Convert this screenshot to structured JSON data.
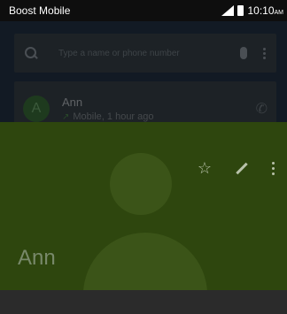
{
  "status_bar": {
    "carrier": "Boost Mobile",
    "time": "10:10",
    "time_suffix": "AM"
  },
  "search": {
    "placeholder": "Type a name or phone number"
  },
  "recent_call": {
    "avatar_letter": "A",
    "name": "Ann",
    "detail": "Mobile, 1 hour ago"
  },
  "contact": {
    "name": "Ann"
  },
  "colors": {
    "header": "#2e460e",
    "top_area": "#121a24",
    "status_bar": "#0e0e0e"
  },
  "icons": [
    "search-icon",
    "mic-icon",
    "more-vert-icon",
    "phone-icon",
    "star-icon",
    "edit-icon",
    "outgoing-call-icon"
  ]
}
